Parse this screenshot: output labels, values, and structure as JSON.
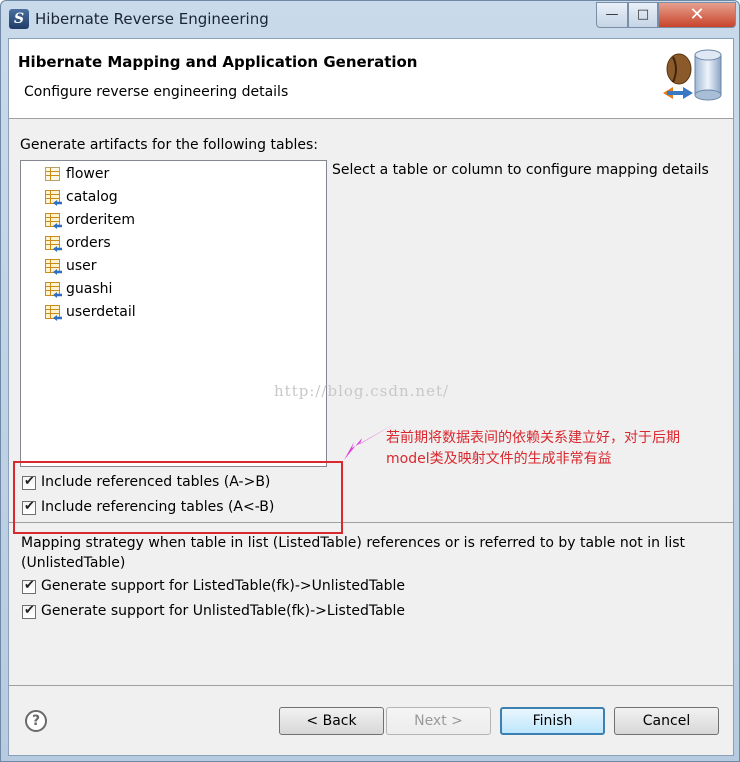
{
  "window": {
    "title": "Hibernate Reverse Engineering",
    "app_icon": "eclipse-logo-icon"
  },
  "titlebar_buttons": {
    "minimize": "—",
    "maximize": "□",
    "close": "✕"
  },
  "header": {
    "title": "Hibernate Mapping and Application Generation",
    "description": "Configure reverse engineering details",
    "image": "database-mapping-icon"
  },
  "tables_section": {
    "label": "Generate artifacts for the following tables:",
    "detail_hint": "Select a table or column to configure mapping details",
    "tables": [
      {
        "name": "flower",
        "icon": "table-icon"
      },
      {
        "name": "catalog",
        "icon": "table-fk-icon"
      },
      {
        "name": "orderitem",
        "icon": "table-fk-icon"
      },
      {
        "name": "orders",
        "icon": "table-fk-icon"
      },
      {
        "name": "user",
        "icon": "table-fk-icon"
      },
      {
        "name": "guashi",
        "icon": "table-fk-icon"
      },
      {
        "name": "userdetail",
        "icon": "table-fk-icon"
      }
    ]
  },
  "options": {
    "include_referenced": {
      "label": "Include referenced tables (A->B)",
      "checked": true
    },
    "include_referencing": {
      "label": "Include referencing tables (A<-B)",
      "checked": true
    }
  },
  "mapping_strategy": {
    "description": "Mapping strategy when table in list (ListedTable) references or is referred to by table not in list (UnlistedTable)",
    "listed_to_unlisted": {
      "label": "Generate support for ListedTable(fk)->UnlistedTable",
      "checked": true
    },
    "unlisted_to_listed": {
      "label": "Generate support for UnlistedTable(fk)->ListedTable",
      "checked": true
    }
  },
  "buttons": {
    "help": "?",
    "back": "< Back",
    "next": "Next >",
    "finish": "Finish",
    "cancel": "Cancel"
  },
  "overlay": {
    "watermark": "http://blog.csdn.net/",
    "annotation_line1": "若前期将数据表间的依赖关系建立好，对于后期",
    "annotation_line2": "model类及映射文件的生成非常有益",
    "annotation_color": "#d9282e"
  }
}
